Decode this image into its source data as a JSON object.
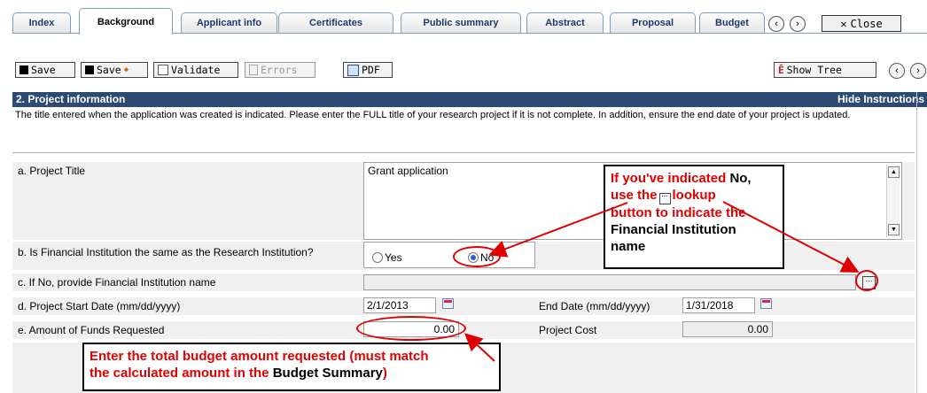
{
  "tabs": [
    "Index",
    "Background",
    "Applicant info",
    "Certificates",
    "Public summary",
    "Abstract",
    "Proposal",
    "Budget"
  ],
  "active_tab": "Background",
  "close_label": "Close",
  "toolbar": {
    "save": "Save",
    "save_plus": "Save",
    "validate": "Validate",
    "errors": "Errors",
    "pdf": "PDF",
    "show_tree": "Show Tree"
  },
  "section": {
    "title": "2. Project information",
    "hide_instructions": "Hide Instructions",
    "instructions": "The title entered when the application was created is indicated. Please enter the FULL title of your research project if it is not complete. In addition, ensure the end date of your project is updated."
  },
  "form": {
    "title_label": "a.  Project Title",
    "title_value": "Grant application",
    "same_label": "b.  Is Financial Institution the same as the Research Institution?",
    "yes": "Yes",
    "no": "No",
    "fi_label": "c.  If No, provide Financial Institution name",
    "start_label": "d.  Project Start Date (mm/dd/yyyy)",
    "start_value": "2/1/2013",
    "end_label": "End Date (mm/dd/yyyy)",
    "end_value": "1/31/2018",
    "funds_label": "e.  Amount of Funds Requested",
    "funds_value": "0.00",
    "cost_label": "Project Cost",
    "cost_value": "0.00"
  },
  "annotations": {
    "fi_note_1": "If you've indicated",
    "fi_note_no": "No,",
    "fi_note_2": "use the",
    "fi_note_3": "lookup",
    "fi_note_4": "button to indicate the",
    "fi_note_5": "Financial Institution",
    "fi_note_6": "name",
    "budget_note_1": "Enter the total budget amount requested (must match",
    "budget_note_2": "the calculated amount in the",
    "budget_note_3": "Budget Summary",
    "budget_note_4": ")"
  },
  "colors": {
    "header_bg": "#2e4a72",
    "annotation_red": "#e00000"
  }
}
